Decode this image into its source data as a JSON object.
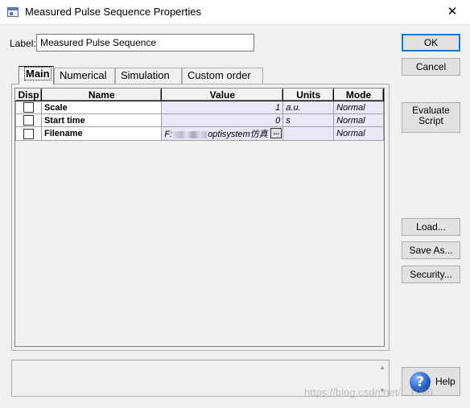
{
  "window": {
    "title": "Measured Pulse Sequence Properties",
    "close_glyph": "✕"
  },
  "label_field": {
    "label": "Label:",
    "value": "Measured Pulse Sequence"
  },
  "buttons": {
    "ok": "OK",
    "cancel": "Cancel",
    "evaluate_line1": "Evaluate",
    "evaluate_line2": "Script",
    "load": "Load...",
    "save_as": "Save As...",
    "security": "Security...",
    "help": "Help"
  },
  "tabs": [
    {
      "label": "Main",
      "active": true
    },
    {
      "label": "Numerical",
      "active": false
    },
    {
      "label": "Simulation",
      "active": false
    },
    {
      "label": "Custom order",
      "active": false
    }
  ],
  "grid": {
    "columns": [
      "Disp",
      "Name",
      "Value",
      "Units",
      "Mode"
    ],
    "rows": [
      {
        "disp": false,
        "name": "Scale",
        "value": "1",
        "units": "a.u.",
        "mode": "Normal"
      },
      {
        "disp": false,
        "name": "Start time",
        "value": "0",
        "units": "s",
        "mode": "Normal"
      },
      {
        "disp": false,
        "name": "Filename",
        "value_prefix": "F:",
        "value_suffix": "optisystem仿真",
        "browse_label": "...",
        "units": "",
        "mode": "Normal"
      }
    ]
  },
  "watermark": "https://blog.csdn.net/...1996",
  "colors": {
    "accent": "#0078d7",
    "cell_tint": "#e8e8f8",
    "dialog_bg": "#f0f0f0"
  },
  "icons": {
    "app": "window-icon",
    "close": "close-icon",
    "help": "help-question-icon"
  }
}
